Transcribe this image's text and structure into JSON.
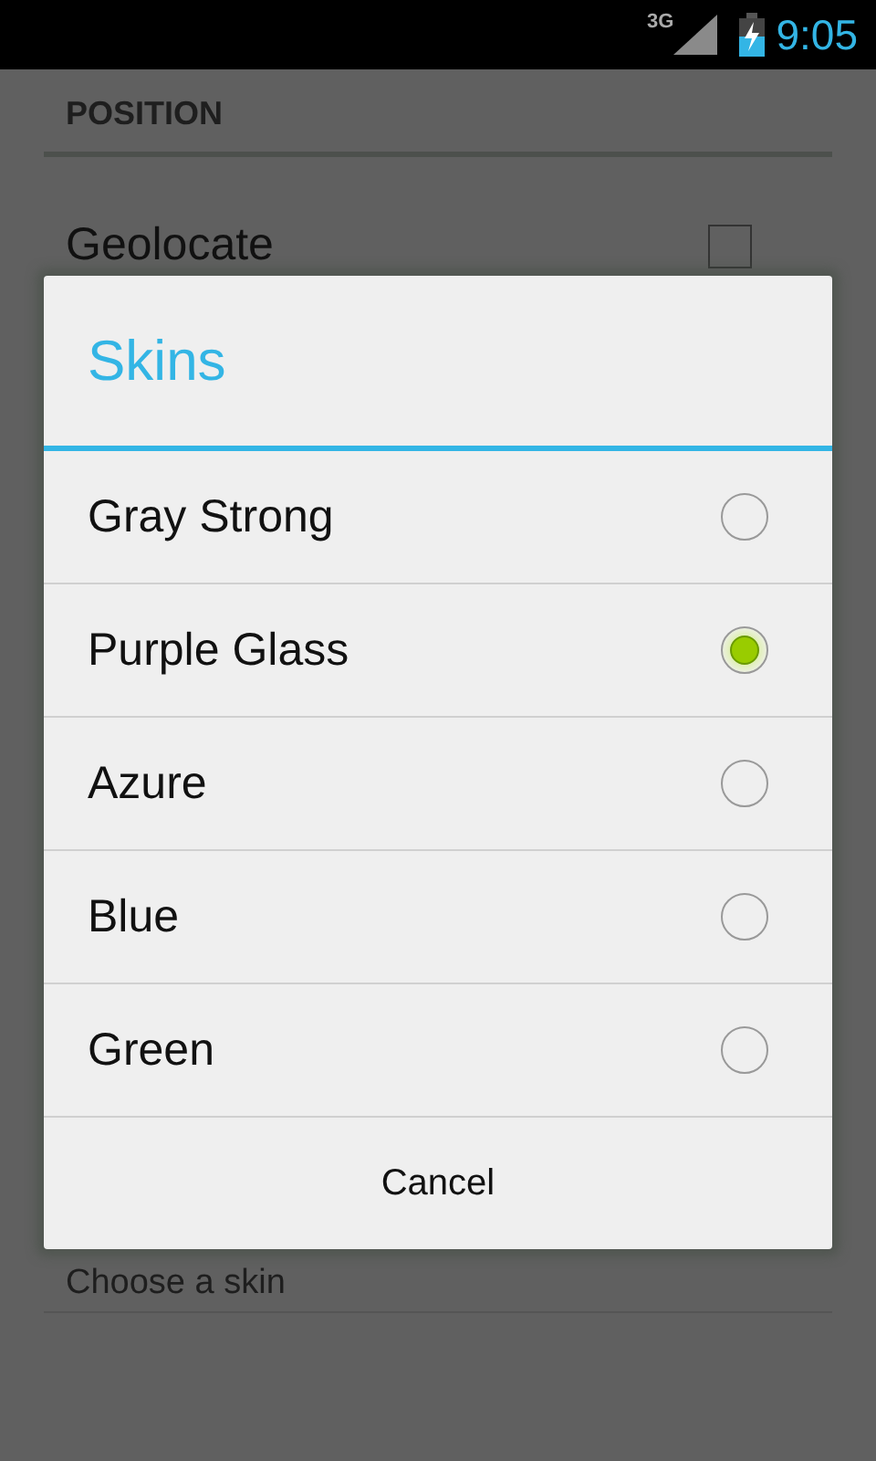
{
  "status_bar": {
    "network": "3G",
    "time": "9:05"
  },
  "settings": {
    "section": "POSITION",
    "items": [
      {
        "kind": "checkbox",
        "label": "Geolocate",
        "checked": false
      },
      {
        "kind": "text",
        "label": "Choose a skin"
      }
    ]
  },
  "dialog": {
    "title": "Skins",
    "options": [
      {
        "label": "Gray Strong",
        "selected": false
      },
      {
        "label": "Purple Glass",
        "selected": true
      },
      {
        "label": "Azure",
        "selected": false
      },
      {
        "label": "Blue",
        "selected": false
      },
      {
        "label": "Green",
        "selected": false
      }
    ],
    "cancel": "Cancel"
  }
}
